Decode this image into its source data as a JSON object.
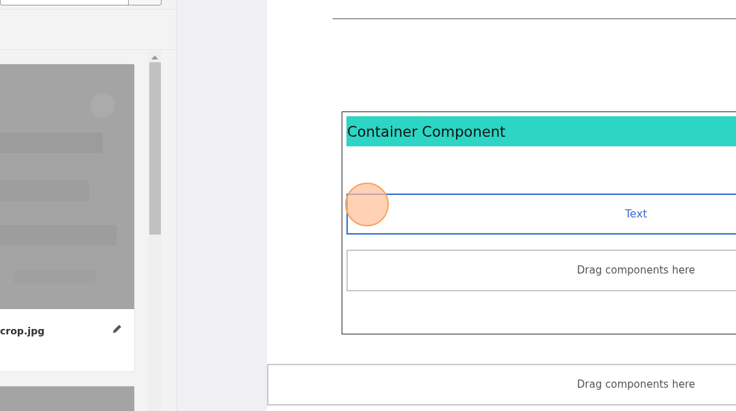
{
  "assets": [
    {
      "kind": "picture",
      "filename": "crop.jpg"
    },
    {
      "kind": "picture"
    }
  ],
  "canvas": {
    "container": {
      "title": "Container Component",
      "children": [
        {
          "kind": "text",
          "label": "Text",
          "selected": true
        },
        {
          "kind": "placeholder",
          "label": "Drag components here",
          "selected": false
        }
      ]
    },
    "placeholder": {
      "label": "Drag components here"
    }
  }
}
